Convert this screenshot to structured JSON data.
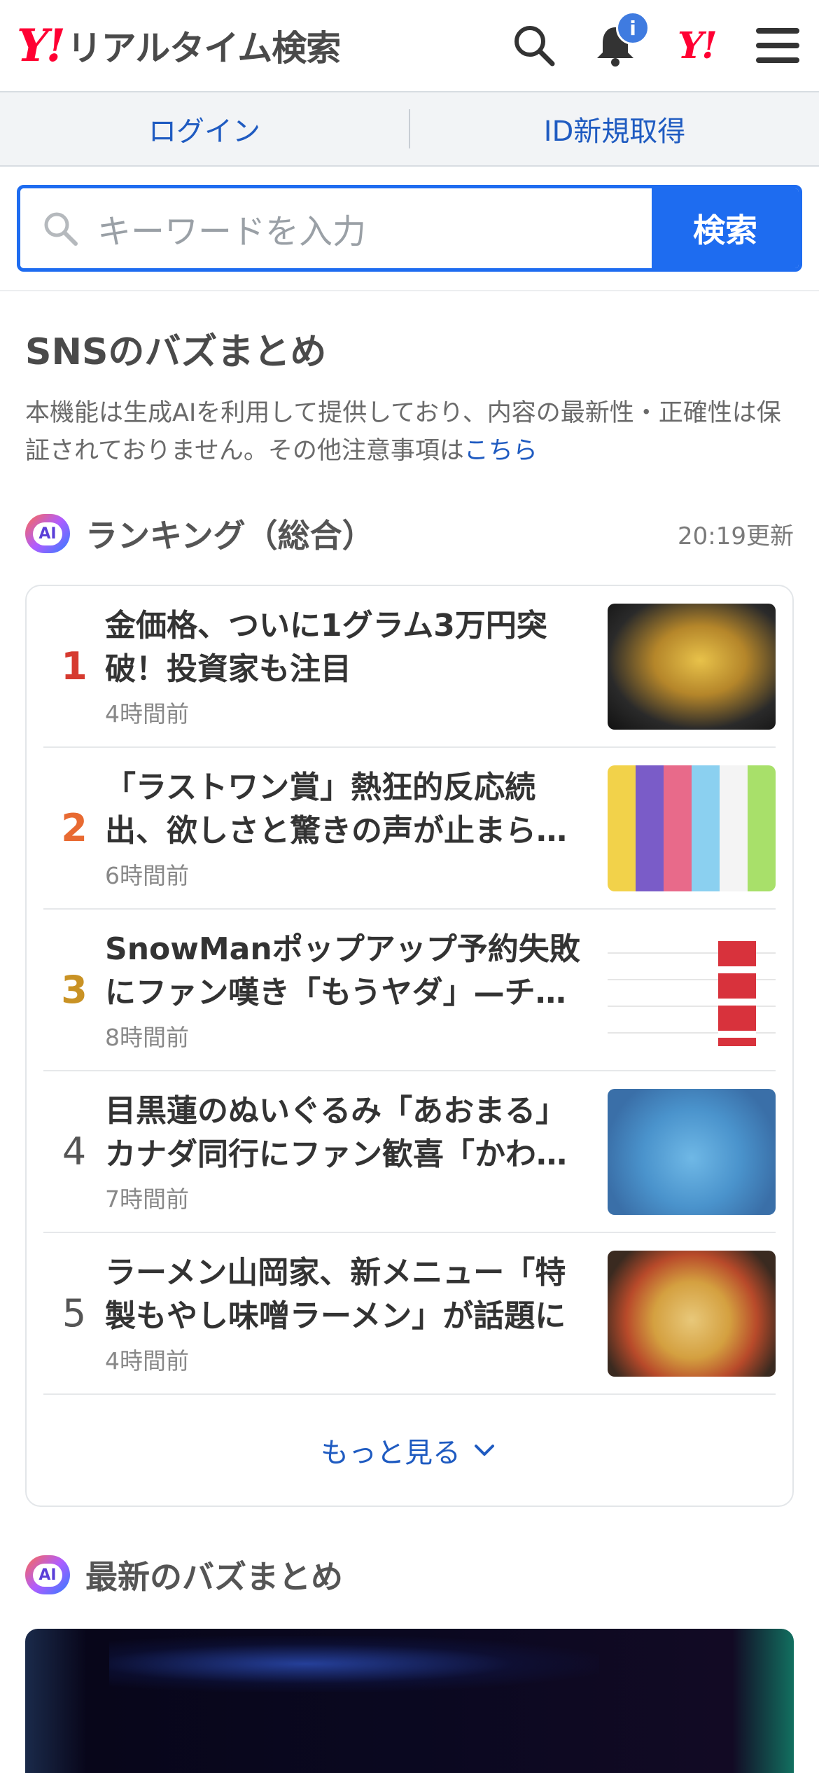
{
  "header": {
    "logo_mark": "Y!",
    "logo_text": "リアルタイム検索",
    "notification_badge": "i",
    "yahoo_mark": "Y!"
  },
  "login_bar": {
    "login": "ログイン",
    "register": "ID新規取得"
  },
  "search": {
    "placeholder": "キーワードを入力",
    "button": "検索"
  },
  "sns": {
    "title": "SNSのバズまとめ",
    "disclaimer": "本機能は生成AIを利用して提供しており、内容の最新性・正確性は保証されておりません。その他注意事項は",
    "disclaimer_link": "こちら"
  },
  "ranking": {
    "badge": "AI",
    "title": "ランキング（総合）",
    "updated": "20:19更新",
    "items": [
      {
        "rank": "1",
        "title": "金価格、ついに1グラム3万円突破！投資家も注目",
        "time": "4時間前",
        "thumb": "gold-bar-image"
      },
      {
        "rank": "2",
        "title": "「ラストワン賞」熱狂的反応続出、欲しさと驚きの声が止まらない",
        "time": "6時間前",
        "thumb": "trading-cards-image"
      },
      {
        "rank": "3",
        "title": "SnowManポップアップ予約失敗にファン嘆き「もうヤダ」—チケット",
        "time": "8時間前",
        "thumb": "reservation-schedule-image"
      },
      {
        "rank": "4",
        "title": "目黒蓮のぬいぐるみ「あおまる」カナダ同行にファン歓喜「かわいい」",
        "time": "7時間前",
        "thumb": "plush-toy-image"
      },
      {
        "rank": "5",
        "title": "ラーメン山岡家、新メニュー「特製もやし味噌ラーメン」が話題に",
        "time": "4時間前",
        "thumb": "ramen-image"
      }
    ],
    "more": "もっと見る"
  },
  "latest": {
    "badge": "AI",
    "title": "最新のバズまとめ"
  },
  "colors": {
    "accent": "#1e6cf0",
    "link": "#1f5bc1",
    "brand_red": "#ff0033",
    "rank1": "#d63a2f",
    "rank2": "#e86a32",
    "rank3": "#c99224"
  }
}
